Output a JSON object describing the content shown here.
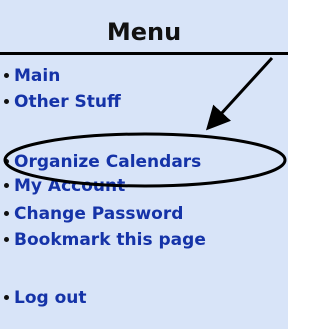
{
  "menu": {
    "title": "Menu",
    "items": [
      {
        "label": "Main"
      },
      {
        "label": "Other Stuff"
      },
      {
        "label": "Organize Calendars"
      },
      {
        "label": "My Account"
      },
      {
        "label": "Change Password"
      },
      {
        "label": "Bookmark this page"
      },
      {
        "label": "Log out"
      }
    ]
  },
  "colors": {
    "panel_background": "#d8e4f8",
    "link_text": "#1533a8",
    "header_text": "#111111",
    "annotation": "#000000"
  },
  "annotation": {
    "shapes": [
      "arrow",
      "ellipse"
    ],
    "highlighted_item": "Organize Calendars"
  }
}
